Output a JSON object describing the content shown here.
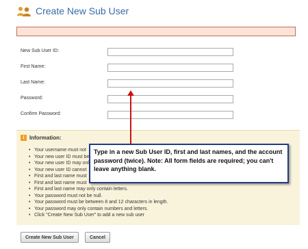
{
  "header": {
    "title": "Create New Sub User",
    "icon": "users-icon"
  },
  "form": {
    "fields": [
      {
        "label": "New Sub User ID:",
        "value": ""
      },
      {
        "label": "First Name:",
        "value": ""
      },
      {
        "label": "Last Name:",
        "value": ""
      },
      {
        "label": "Password:",
        "value": ""
      },
      {
        "label": "Confirm Password:",
        "value": ""
      }
    ]
  },
  "info": {
    "title": "Information:",
    "rules": [
      "Your username must not",
      "Your new user ID must be",
      "Your new user ID may onl",
      "Your new user ID cannot",
      "First and last name must",
      "First and last name must",
      "First and last name may only contain letters.",
      "Your password must not be null.",
      "Your password must be between 8 and 12 characters in length.",
      "Your password may only contain numbers and letters.",
      "Click \"Create New Sub User\" to add a new sub user"
    ]
  },
  "callout": {
    "text": "Type in a new Sub User ID, first and last names, and the account password (twice). Note: All form fields are required; you can't leave anything blank."
  },
  "buttons": {
    "create": "Create New Sub User",
    "cancel": "Cancel"
  },
  "colors": {
    "title": "#3a6aa8",
    "error_bg": "#fbe3d9",
    "error_border": "#c96b4f",
    "info_bg": "#faf3dc",
    "callout_border": "#1f3b84",
    "arrow": "#cc1010"
  }
}
